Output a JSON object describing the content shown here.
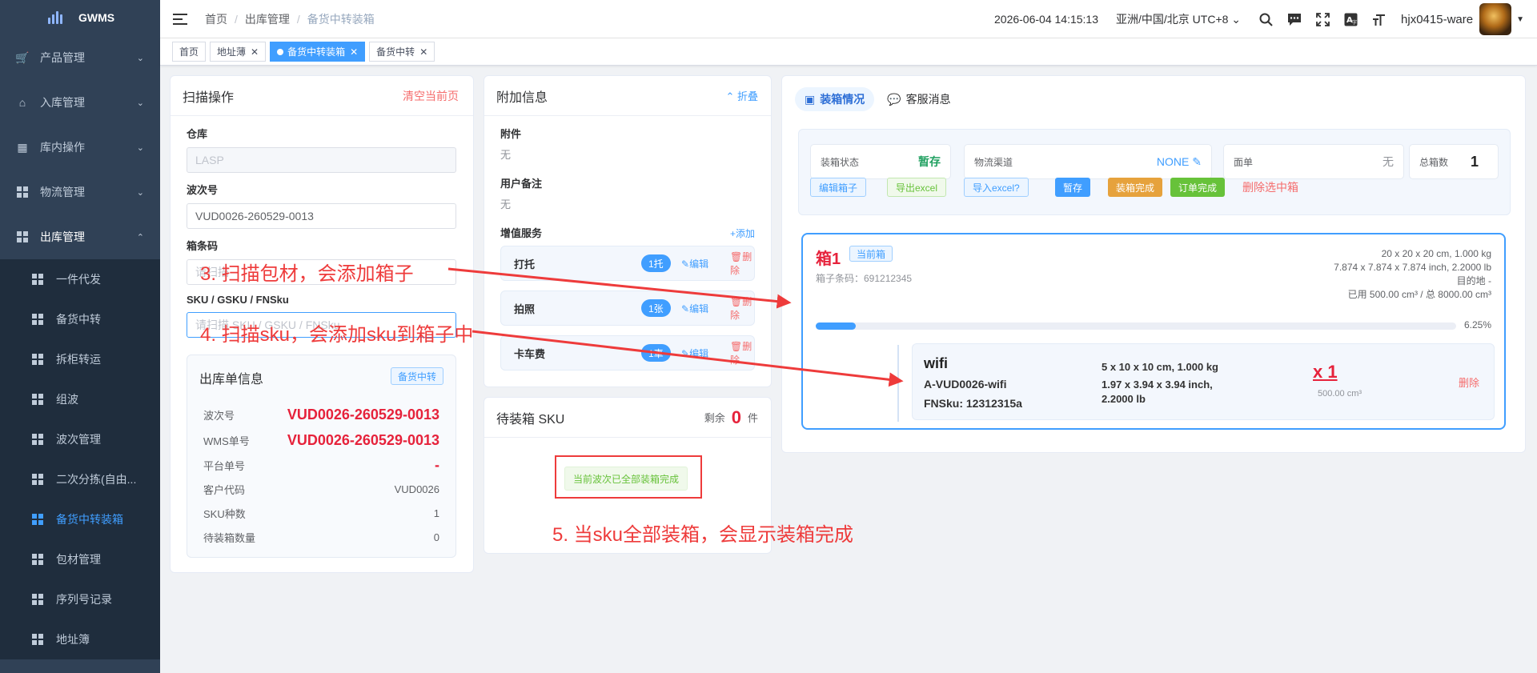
{
  "app": {
    "name": "GWMS"
  },
  "sidebar": {
    "items": [
      {
        "label": "产品管理",
        "icon": "cart-icon"
      },
      {
        "label": "入库管理",
        "icon": "home-icon"
      },
      {
        "label": "库内操作",
        "icon": "table-icon"
      },
      {
        "label": "物流管理",
        "icon": "grid-icon"
      },
      {
        "label": "出库管理",
        "icon": "grid-icon"
      }
    ],
    "sub_items": [
      "一件代发",
      "备货中转",
      "拆柜转运",
      "组波",
      "波次管理",
      "二次分拣(自由...",
      "备货中转装箱",
      "包材管理",
      "序列号记录",
      "地址簿"
    ]
  },
  "header": {
    "breadcrumb": [
      "首页",
      "出库管理",
      "备货中转装箱"
    ],
    "datetime": "2026-06-04 14:15:13",
    "timezone": "亚洲/中国/北京 UTC+8",
    "username": "hjx0415-ware"
  },
  "tags": [
    {
      "label": "首页",
      "closable": false,
      "active": false
    },
    {
      "label": "地址薄",
      "closable": true,
      "active": false
    },
    {
      "label": "备货中转装箱",
      "closable": true,
      "active": true
    },
    {
      "label": "备货中转",
      "closable": true,
      "active": false
    }
  ],
  "scan": {
    "title": "扫描操作",
    "clear": "清空当前页",
    "warehouse_label": "仓库",
    "warehouse_value": "LASP",
    "wave_label": "波次号",
    "wave_value": "VUD0026-260529-0013",
    "barcode_label": "箱条码",
    "barcode_placeholder": "请扫描",
    "sku_label": "SKU / GSKU / FNSku",
    "sku_placeholder": "请扫描 SKU / GSKU / FNSku"
  },
  "order_info": {
    "title": "出库单信息",
    "tag": "备货中转",
    "rows": [
      {
        "label": "波次号",
        "value": "VUD0026-260529-0013"
      },
      {
        "label": "WMS单号",
        "value": "VUD0026-260529-0013"
      },
      {
        "label": "平台单号",
        "value": "-"
      },
      {
        "label": "客户代码",
        "value": "VUD0026"
      },
      {
        "label": "SKU种数",
        "value": "1"
      },
      {
        "label": "待装箱数量",
        "value": "0"
      }
    ]
  },
  "extra": {
    "title": "附加信息",
    "fold": "折叠",
    "attachment_label": "附件",
    "attachment_value": "无",
    "remark_label": "用户备注",
    "remark_value": "无",
    "service_label": "增值服务",
    "add": "+添加",
    "services": [
      {
        "name": "打托",
        "count": "1托"
      },
      {
        "name": "拍照",
        "count": "1张"
      },
      {
        "name": "卡车费",
        "count": "1車"
      }
    ],
    "edit": "编辑",
    "delete": "删除"
  },
  "pending": {
    "title": "待装箱 SKU",
    "remain_label": "剩余",
    "remain_value": "0",
    "unit": "件",
    "done_text": "当前波次已全部装箱完成"
  },
  "right": {
    "tabs": [
      "装箱情况",
      "客服消息"
    ],
    "status_label": "装箱状态",
    "status_value": "暂存",
    "channel_label": "物流渠道",
    "channel_value": "NONE",
    "waybill_label": "面单",
    "waybill_value": "无",
    "total_label": "总箱数",
    "total_value": "1",
    "buttons": [
      "编辑箱子",
      "导出excel",
      "导入excel?",
      "暂存",
      "装箱完成",
      "订单完成",
      "删除选中箱"
    ],
    "box": {
      "title": "箱1",
      "current": "当前箱",
      "barcode": "箱子条码：691212345",
      "dims_cm": "20 x 20 x 20 cm, 1.000 kg",
      "dims_in": "7.874 x 7.874 x 7.874 inch, 2.2000 lb",
      "dest": "目的地 -",
      "usage": "已用 500.00 cm³ / 总 8000.00 cm³",
      "progress": 6.25,
      "progress_text": "6.25%",
      "item": {
        "name": "wifi",
        "sku": "A-VUD0026-wifi",
        "fnsku": "FNSku: 12312315a",
        "dims_cm": "5 x 10 x 10 cm, 1.000 kg",
        "dims_in": "1.97 x 3.94 x 3.94 inch,",
        "weight_lb": "2.2000 lb",
        "qty": "x 1",
        "volume": "500.00 cm³",
        "delete": "删除"
      }
    }
  },
  "annotations": {
    "a3": "3. 扫描包材，会添加箱子",
    "a4": "4. 扫描sku，会添加sku到箱子中",
    "a5": "5. 当sku全部装箱，会显示装箱完成"
  },
  "colors": {
    "accent": "#409eff",
    "sidebar": "#304156",
    "annotation": "#ee3b3b",
    "success": "#67c23a",
    "warning": "#e6a23c"
  }
}
